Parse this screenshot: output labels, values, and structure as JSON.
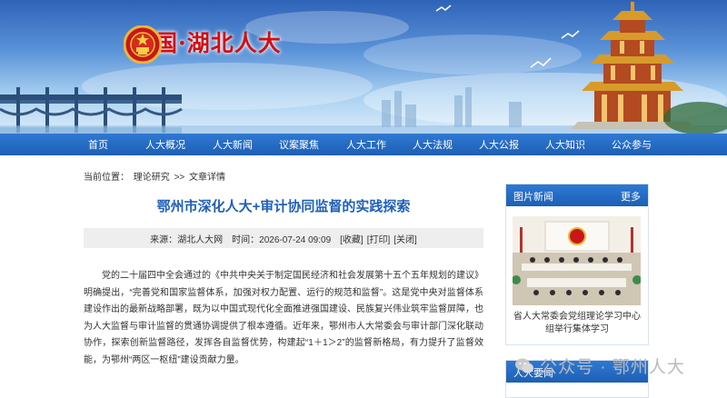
{
  "site": {
    "title": "中国·湖北人大"
  },
  "nav": {
    "items": [
      "首页",
      "人大概况",
      "人大新闻",
      "议案聚焦",
      "人大工作",
      "人大法规",
      "人大公报",
      "人大知识",
      "公众参与"
    ]
  },
  "breadcrumb": {
    "label": "当前位置：",
    "crumb1": "理论研究",
    "sep": ">>",
    "crumb2": "文章详情"
  },
  "article": {
    "title": "鄂州市深化人大+审计协同监督的实践探索",
    "source": "来源：湖北人大网",
    "time": "时间：2026-07-24 09:09",
    "collect": "[收藏]",
    "print": "[打印]",
    "close": "[关闭]",
    "body": "党的二十届四中全会通过的《中共中央关于制定国民经济和社会发展第十五个五年规划的建议》明确提出，“完善党和国家监督体系，加强对权力配置、运行的规范和监督”。这是党中央对监督体系建设作出的最新战略部署，既为以中国式现代化全面推进强国建设、民族复兴伟业筑牢监督屏障，也为人大监督与审计监督的贯通协调提供了根本遵循。近年来，鄂州市人大常委会与审计部门深化联动协作，探索创新监督路径，发挥各自监督优势，构建起“1＋1＞2”的监督新格局，有力提升了监督效能，为鄂州“两区一枢纽”建设贡献力量。"
  },
  "sidebar": {
    "photo_news": {
      "title": "图片新闻",
      "more": "更多",
      "caption": "省人大常委会党组理论学习中心组举行集体学习"
    },
    "important": {
      "title": "人大要闻"
    }
  },
  "watermark": {
    "text": "公众号 · 鄂州人大"
  },
  "colors": {
    "nav_blue": "#1d5fb5",
    "title_blue": "#1f5fb8",
    "brand_red": "#d10f12"
  }
}
